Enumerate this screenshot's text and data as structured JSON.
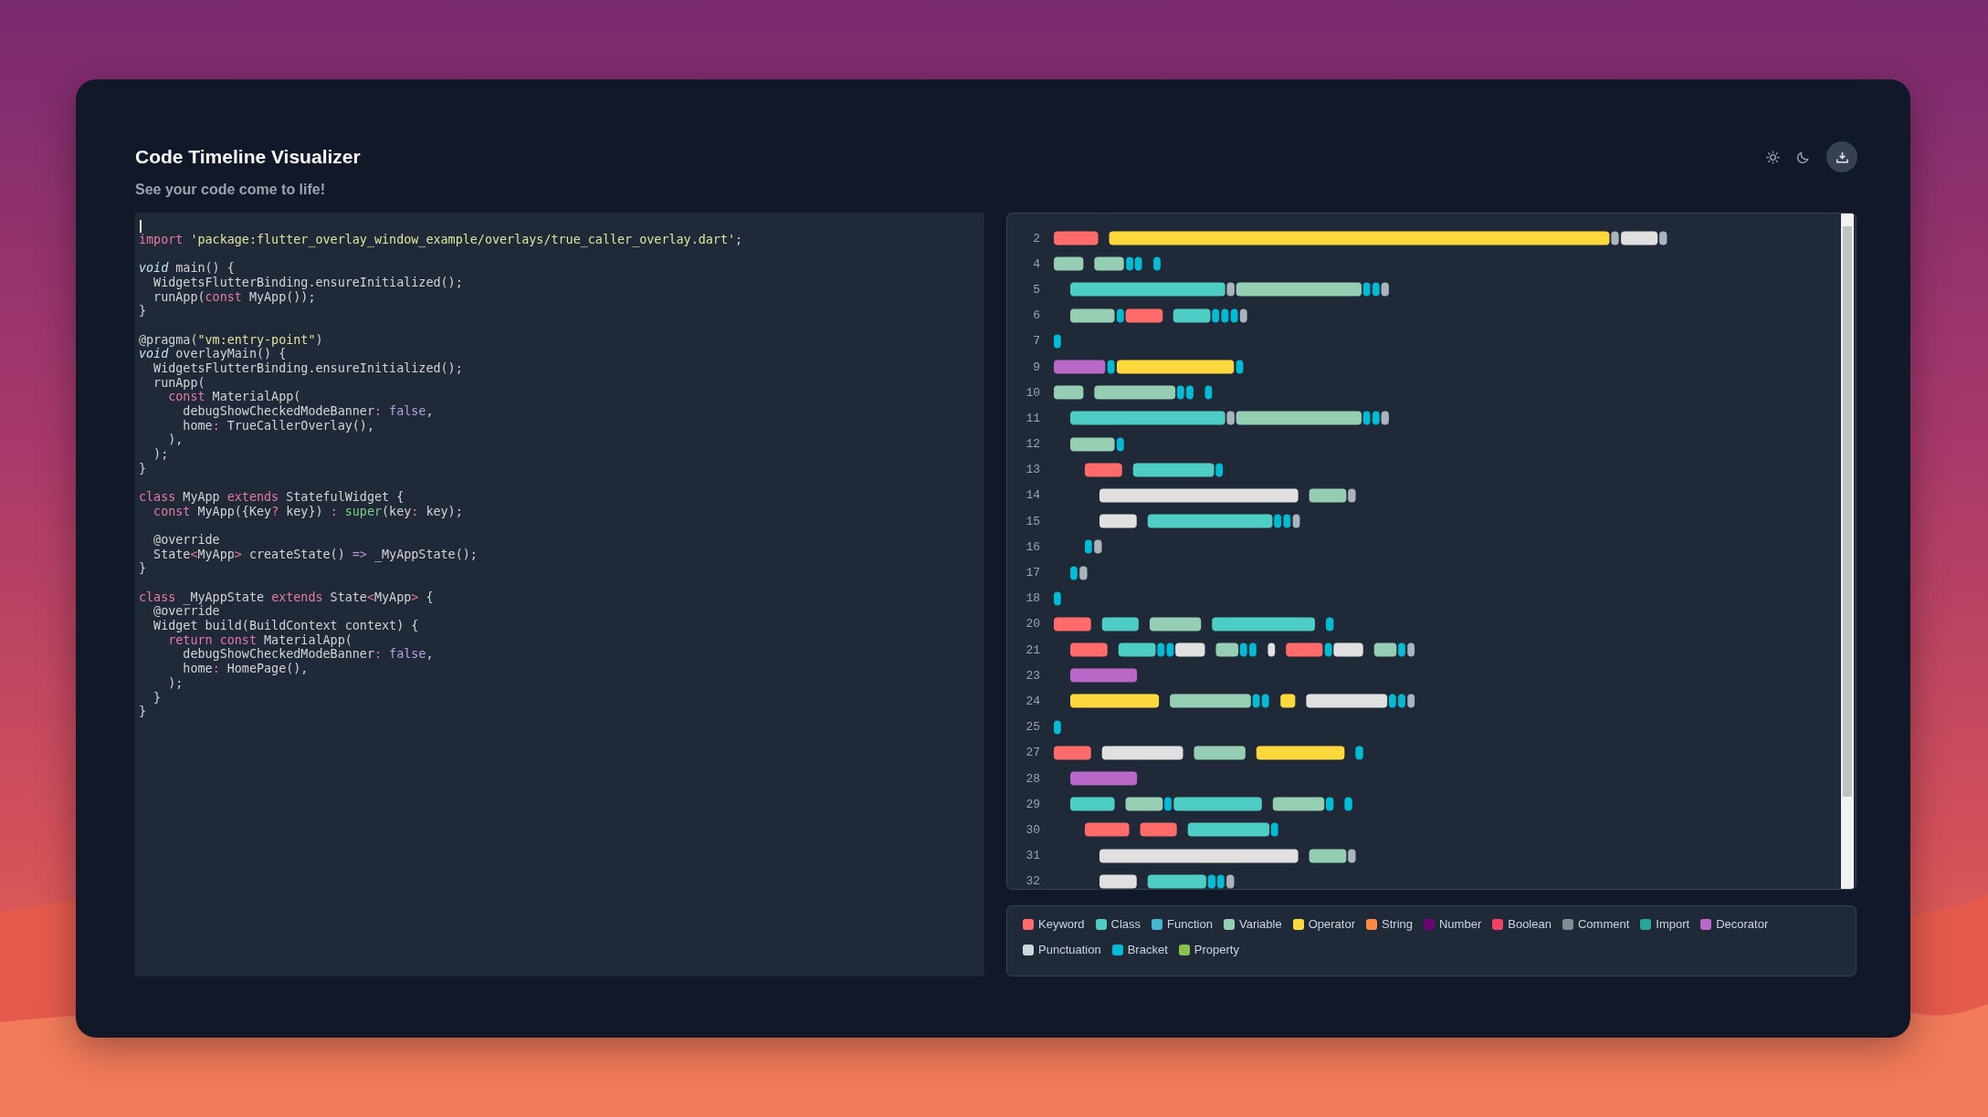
{
  "app": {
    "title": "Code Timeline Visualizer",
    "subtitle": "See your code come to life!"
  },
  "code": {
    "lines": [
      {
        "kind": "code",
        "tokens": [
          {
            "text": "import ",
            "kind": "keyword"
          },
          {
            "text": "'package:flutter_overlay_window_example/overlays/true_caller_overlay.dart'",
            "kind": "string"
          },
          {
            "text": ";",
            "kind": "plain"
          }
        ]
      },
      {
        "kind": "blank"
      },
      {
        "kind": "code",
        "tokens": [
          {
            "text": "void",
            "kind": "type"
          },
          {
            "text": " main() {",
            "kind": "plain"
          }
        ]
      },
      {
        "kind": "code",
        "tokens": [
          {
            "text": "  WidgetsFlutterBinding.ensureInitialized();",
            "kind": "plain"
          }
        ]
      },
      {
        "kind": "code",
        "tokens": [
          {
            "text": "  runApp(",
            "kind": "plain"
          },
          {
            "text": "const",
            "kind": "keyword"
          },
          {
            "text": " MyApp());",
            "kind": "plain"
          }
        ]
      },
      {
        "kind": "code",
        "tokens": [
          {
            "text": "}",
            "kind": "plain"
          }
        ]
      },
      {
        "kind": "blank"
      },
      {
        "kind": "code",
        "tokens": [
          {
            "text": "@pragma(",
            "kind": "plain"
          },
          {
            "text": "\"vm:entry-point\"",
            "kind": "string"
          },
          {
            "text": ")",
            "kind": "plain"
          }
        ]
      },
      {
        "kind": "code",
        "tokens": [
          {
            "text": "void",
            "kind": "type"
          },
          {
            "text": " overlayMain() {",
            "kind": "plain"
          }
        ]
      },
      {
        "kind": "code",
        "tokens": [
          {
            "text": "  WidgetsFlutterBinding.ensureInitialized();",
            "kind": "plain"
          }
        ]
      },
      {
        "kind": "code",
        "tokens": [
          {
            "text": "  runApp(",
            "kind": "plain"
          }
        ]
      },
      {
        "kind": "code",
        "tokens": [
          {
            "text": "    const",
            "kind": "keyword"
          },
          {
            "text": " MaterialApp(",
            "kind": "plain"
          }
        ]
      },
      {
        "kind": "code",
        "tokens": [
          {
            "text": "      debugShowCheckedModeBanner",
            "kind": "plain"
          },
          {
            "text": ": ",
            "kind": "operator"
          },
          {
            "text": "false",
            "kind": "literal"
          },
          {
            "text": ",",
            "kind": "plain"
          }
        ]
      },
      {
        "kind": "code",
        "tokens": [
          {
            "text": "      home",
            "kind": "plain"
          },
          {
            "text": ":",
            "kind": "operator"
          },
          {
            "text": " TrueCallerOverlay(),",
            "kind": "plain"
          }
        ]
      },
      {
        "kind": "code",
        "tokens": [
          {
            "text": "    ),",
            "kind": "plain"
          }
        ]
      },
      {
        "kind": "code",
        "tokens": [
          {
            "text": "  );",
            "kind": "plain"
          }
        ]
      },
      {
        "kind": "code",
        "tokens": [
          {
            "text": "}",
            "kind": "plain"
          }
        ]
      },
      {
        "kind": "blank"
      },
      {
        "kind": "code",
        "tokens": [
          {
            "text": "class",
            "kind": "keyword"
          },
          {
            "text": " MyApp ",
            "kind": "plain"
          },
          {
            "text": "extends",
            "kind": "keyword"
          },
          {
            "text": " StatefulWidget {",
            "kind": "plain"
          }
        ]
      },
      {
        "kind": "code",
        "tokens": [
          {
            "text": "  const",
            "kind": "keyword"
          },
          {
            "text": " MyApp({Key",
            "kind": "plain"
          },
          {
            "text": "?",
            "kind": "operator"
          },
          {
            "text": " key}) ",
            "kind": "plain"
          },
          {
            "text": ": ",
            "kind": "operator"
          },
          {
            "text": "super",
            "kind": "builtin"
          },
          {
            "text": "(key",
            "kind": "plain"
          },
          {
            "text": ":",
            "kind": "operator"
          },
          {
            "text": " key);",
            "kind": "plain"
          }
        ]
      },
      {
        "kind": "blank"
      },
      {
        "kind": "code",
        "tokens": [
          {
            "text": "  @override",
            "kind": "plain"
          }
        ]
      },
      {
        "kind": "code",
        "tokens": [
          {
            "text": "  State",
            "kind": "plain"
          },
          {
            "text": "<",
            "kind": "operator"
          },
          {
            "text": "MyApp",
            "kind": "plain"
          },
          {
            "text": ">",
            "kind": "operator"
          },
          {
            "text": " createState() ",
            "kind": "plain"
          },
          {
            "text": "=>",
            "kind": "arrow"
          },
          {
            "text": " _MyAppState();",
            "kind": "plain"
          }
        ]
      },
      {
        "kind": "code",
        "tokens": [
          {
            "text": "}",
            "kind": "plain"
          }
        ]
      },
      {
        "kind": "blank"
      },
      {
        "kind": "code",
        "tokens": [
          {
            "text": "class",
            "kind": "keyword"
          },
          {
            "text": " _MyAppState ",
            "kind": "plain"
          },
          {
            "text": "extends",
            "kind": "keyword"
          },
          {
            "text": " State",
            "kind": "plain"
          },
          {
            "text": "<",
            "kind": "operator"
          },
          {
            "text": "MyApp",
            "kind": "plain"
          },
          {
            "text": ">",
            "kind": "operator"
          },
          {
            "text": " {",
            "kind": "plain"
          }
        ]
      },
      {
        "kind": "code",
        "tokens": [
          {
            "text": "  @override",
            "kind": "plain"
          }
        ]
      },
      {
        "kind": "code",
        "tokens": [
          {
            "text": "  Widget build(BuildContext context) {",
            "kind": "plain"
          }
        ]
      },
      {
        "kind": "code",
        "tokens": [
          {
            "text": "    return const",
            "kind": "keyword"
          },
          {
            "text": " MaterialApp(",
            "kind": "plain"
          }
        ]
      },
      {
        "kind": "code",
        "tokens": [
          {
            "text": "      debugShowCheckedModeBanner",
            "kind": "plain"
          },
          {
            "text": ": ",
            "kind": "operator"
          },
          {
            "text": "false",
            "kind": "literal"
          },
          {
            "text": ",",
            "kind": "plain"
          }
        ]
      },
      {
        "kind": "code",
        "tokens": [
          {
            "text": "      home",
            "kind": "plain"
          },
          {
            "text": ":",
            "kind": "operator"
          },
          {
            "text": " HomePage(),",
            "kind": "plain"
          }
        ]
      },
      {
        "kind": "code",
        "tokens": [
          {
            "text": "    );",
            "kind": "plain"
          }
        ]
      },
      {
        "kind": "code",
        "tokens": [
          {
            "text": "  }",
            "kind": "plain"
          }
        ]
      },
      {
        "kind": "code",
        "tokens": [
          {
            "text": "}",
            "kind": "plain"
          }
        ]
      }
    ]
  },
  "timeline": {
    "rows": [
      {
        "line": "2"
      },
      {
        "line": "4"
      },
      {
        "line": "5"
      },
      {
        "line": "6"
      },
      {
        "line": "7"
      },
      {
        "line": "9"
      },
      {
        "line": "10"
      },
      {
        "line": "11"
      },
      {
        "line": "12"
      },
      {
        "line": "13"
      },
      {
        "line": "14"
      },
      {
        "line": "15"
      },
      {
        "line": "16"
      },
      {
        "line": "17"
      },
      {
        "line": "18"
      },
      {
        "line": "20"
      },
      {
        "line": "21"
      },
      {
        "line": "23"
      },
      {
        "line": "24"
      },
      {
        "line": "25"
      },
      {
        "line": "27"
      },
      {
        "line": "28"
      },
      {
        "line": "29"
      },
      {
        "line": "30"
      },
      {
        "line": "31"
      },
      {
        "line": "32"
      }
    ]
  },
  "legend": [
    {
      "label": "Keyword",
      "color": "#ff6b6b"
    },
    {
      "label": "Class",
      "color": "#4ecdc4"
    },
    {
      "label": "Function",
      "color": "#45b7d1"
    },
    {
      "label": "Variable",
      "color": "#96ceb4"
    },
    {
      "label": "Operator",
      "color": "#ffd93d"
    },
    {
      "label": "String",
      "color": "#ff8c42"
    },
    {
      "label": "Number",
      "color": "#6a0572"
    },
    {
      "label": "Boolean",
      "color": "#ee4266"
    },
    {
      "label": "Comment",
      "color": "#7d8e95"
    },
    {
      "label": "Import",
      "color": "#26a69a"
    },
    {
      "label": "Decorator",
      "color": "#ba68c8"
    },
    {
      "label": "Punctuation",
      "color": "#cfd8dc"
    },
    {
      "label": "Bracket",
      "color": "#00bcd4"
    },
    {
      "label": "Property",
      "color": "#8bc34a"
    }
  ]
}
